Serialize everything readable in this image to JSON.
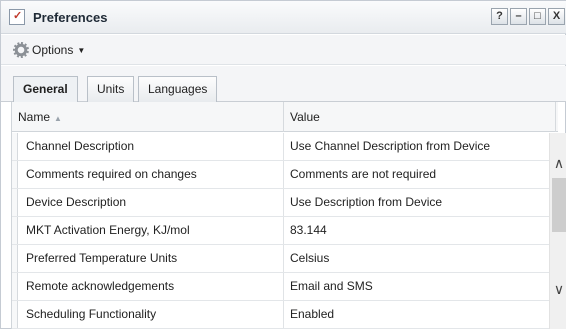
{
  "window": {
    "title": "Preferences",
    "buttons": {
      "help": "?",
      "minimize": "–",
      "maximize": "□",
      "close": "X"
    }
  },
  "toolbar": {
    "options_label": "Options",
    "options_icon": "gear-icon"
  },
  "tabs": [
    {
      "label": "General",
      "active": true
    },
    {
      "label": "Units",
      "active": false
    },
    {
      "label": "Languages",
      "active": false
    }
  ],
  "grid": {
    "columns": {
      "name": "Name",
      "value": "Value"
    },
    "rows": [
      {
        "name": "Channel Description",
        "value": "Use Channel Description from Device"
      },
      {
        "name": "Comments required on changes",
        "value": "Comments are not required"
      },
      {
        "name": "Device Description",
        "value": "Use Description from Device"
      },
      {
        "name": "MKT Activation Energy, KJ/mol",
        "value": "83.144"
      },
      {
        "name": "Preferred Temperature Units",
        "value": "Celsius"
      },
      {
        "name": "Remote acknowledgements",
        "value": "Email and SMS"
      },
      {
        "name": "Scheduling Functionality",
        "value": "Enabled"
      }
    ]
  },
  "scrollbar": {
    "up": "^",
    "down": "v"
  }
}
